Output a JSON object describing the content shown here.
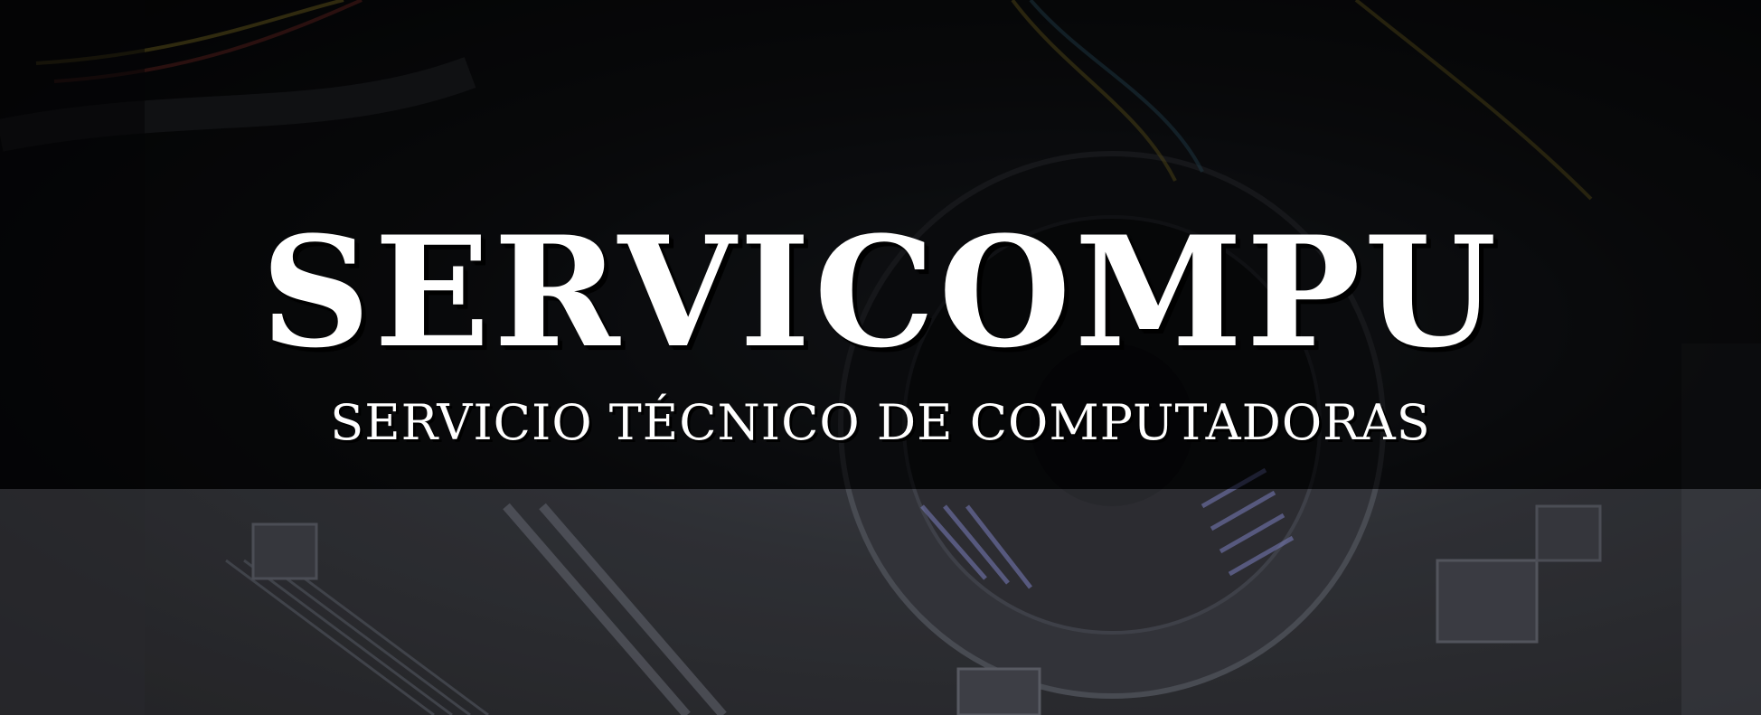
{
  "banner": {
    "title": "SERVICOMPU",
    "subtitle": "SERVICIO TÉCNICO DE COMPUTADORAS"
  },
  "background": {
    "description_icon": "motherboard-photo",
    "colors": {
      "base": "#050505",
      "accent_blue": "#8a8ff0",
      "wire_yellow": "#c9b23a",
      "wire_red": "#b2403a"
    }
  }
}
